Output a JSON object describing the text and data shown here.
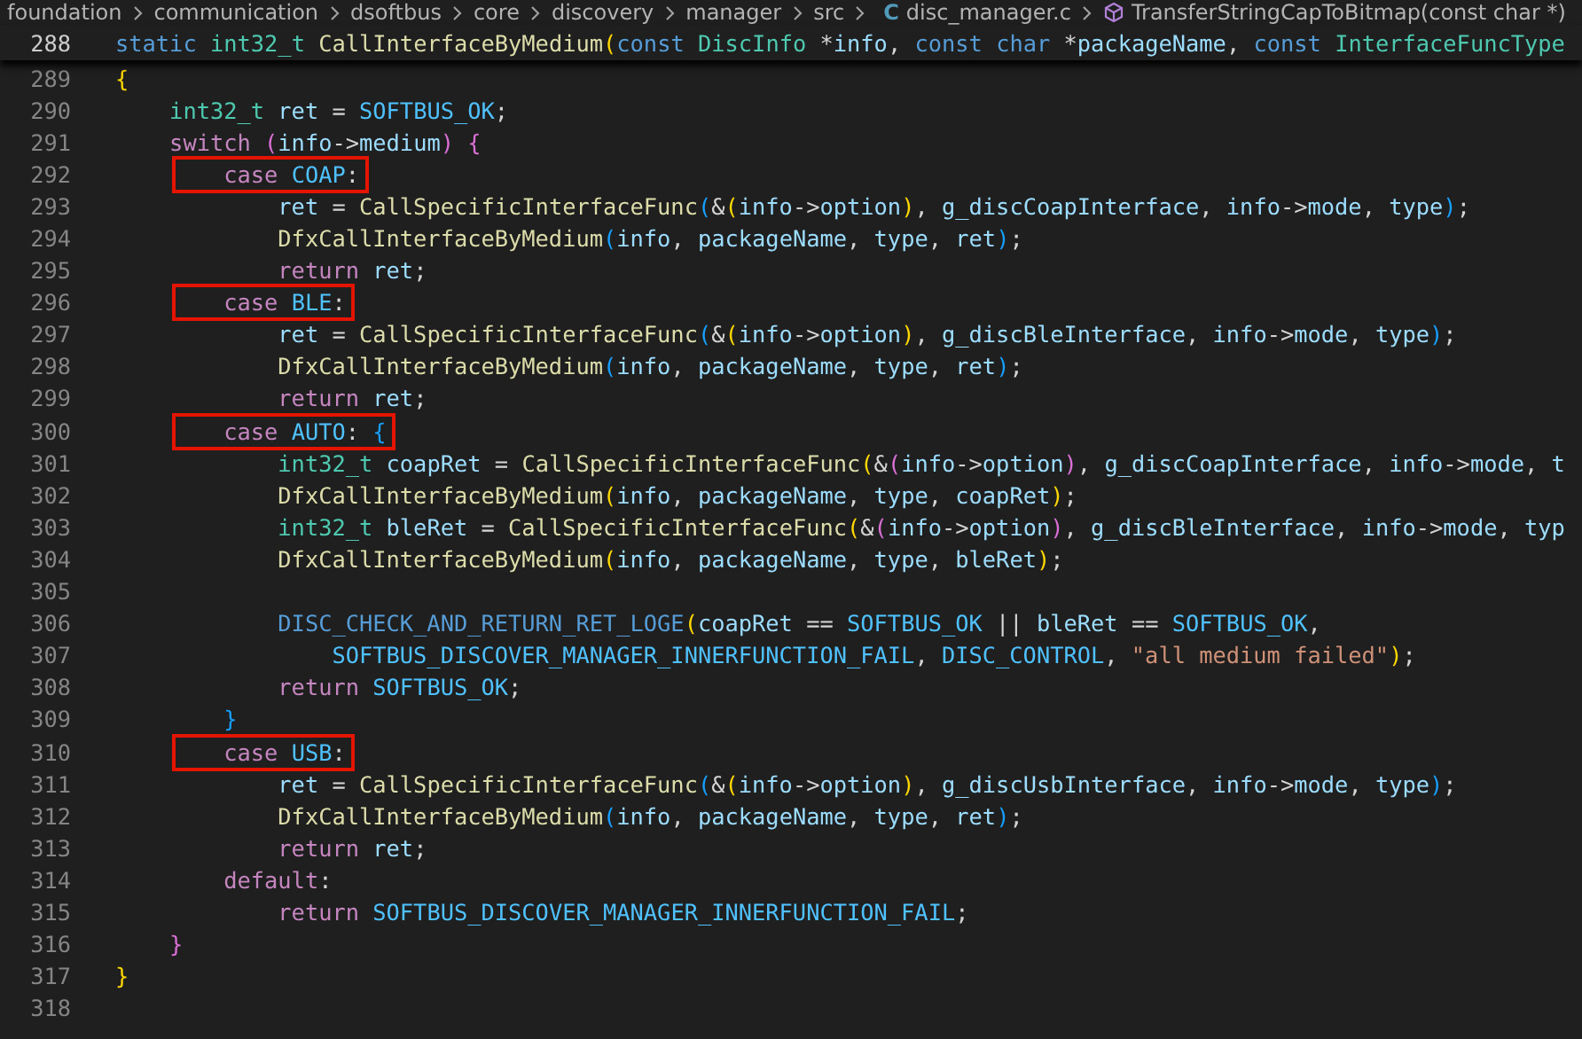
{
  "breadcrumb": {
    "segments": [
      "foundation",
      "communication",
      "dsoftbus",
      "core",
      "discovery",
      "manager",
      "src"
    ],
    "file_icon": "C",
    "file": "disc_manager.c",
    "symbol": "TransferStringCapToBitmap(const char *)"
  },
  "sticky_line": {
    "number": "288",
    "tokens": [
      {
        "kind": "st",
        "text": "static "
      },
      {
        "kind": "ty",
        "text": "int32_t "
      },
      {
        "kind": "fn",
        "text": "CallInterfaceByMedium"
      },
      {
        "kind": "br1",
        "text": "("
      },
      {
        "kind": "st",
        "text": "const "
      },
      {
        "kind": "ty",
        "text": "DiscInfo"
      },
      {
        "kind": "punct",
        "text": " *"
      },
      {
        "kind": "var",
        "text": "info"
      },
      {
        "kind": "punct",
        "text": ", "
      },
      {
        "kind": "st",
        "text": "const char"
      },
      {
        "kind": "punct",
        "text": " *"
      },
      {
        "kind": "var",
        "text": "packageName"
      },
      {
        "kind": "punct",
        "text": ", "
      },
      {
        "kind": "st",
        "text": "const "
      },
      {
        "kind": "ty",
        "text": "InterfaceFuncType"
      }
    ]
  },
  "lines": [
    {
      "number": "289",
      "highlighted": false,
      "tokens": [
        {
          "kind": "br1",
          "text": "{"
        }
      ]
    },
    {
      "number": "290",
      "highlighted": false,
      "tokens": [
        {
          "kind": "ty",
          "text": "    int32_t "
        },
        {
          "kind": "var",
          "text": "ret"
        },
        {
          "kind": "punct",
          "text": " = "
        },
        {
          "kind": "const",
          "text": "SOFTBUS_OK"
        },
        {
          "kind": "punct",
          "text": ";"
        }
      ]
    },
    {
      "number": "291",
      "highlighted": false,
      "tokens": [
        {
          "kind": "kw",
          "text": "    switch "
        },
        {
          "kind": "br2",
          "text": "("
        },
        {
          "kind": "var",
          "text": "info"
        },
        {
          "kind": "punct",
          "text": "->"
        },
        {
          "kind": "var",
          "text": "medium"
        },
        {
          "kind": "br2",
          "text": ") {"
        }
      ]
    },
    {
      "number": "292",
      "highlighted": true,
      "tokens": [
        {
          "kind": "kw",
          "text": "        case "
        },
        {
          "kind": "const",
          "text": "COAP"
        },
        {
          "kind": "punct",
          "text": ":"
        }
      ]
    },
    {
      "number": "293",
      "highlighted": false,
      "tokens": [
        {
          "kind": "var",
          "text": "            ret"
        },
        {
          "kind": "punct",
          "text": " = "
        },
        {
          "kind": "fn",
          "text": "CallSpecificInterfaceFunc"
        },
        {
          "kind": "br3",
          "text": "("
        },
        {
          "kind": "punct",
          "text": "&"
        },
        {
          "kind": "br1",
          "text": "("
        },
        {
          "kind": "var",
          "text": "info"
        },
        {
          "kind": "punct",
          "text": "->"
        },
        {
          "kind": "var",
          "text": "option"
        },
        {
          "kind": "br1",
          "text": ")"
        },
        {
          "kind": "punct",
          "text": ", "
        },
        {
          "kind": "var",
          "text": "g_discCoapInterface"
        },
        {
          "kind": "punct",
          "text": ", "
        },
        {
          "kind": "var",
          "text": "info"
        },
        {
          "kind": "punct",
          "text": "->"
        },
        {
          "kind": "var",
          "text": "mode"
        },
        {
          "kind": "punct",
          "text": ", "
        },
        {
          "kind": "var",
          "text": "type"
        },
        {
          "kind": "br3",
          "text": ")"
        },
        {
          "kind": "punct",
          "text": ";"
        }
      ]
    },
    {
      "number": "294",
      "highlighted": false,
      "tokens": [
        {
          "kind": "fn",
          "text": "            DfxCallInterfaceByMedium"
        },
        {
          "kind": "br3",
          "text": "("
        },
        {
          "kind": "var",
          "text": "info"
        },
        {
          "kind": "punct",
          "text": ", "
        },
        {
          "kind": "var",
          "text": "packageName"
        },
        {
          "kind": "punct",
          "text": ", "
        },
        {
          "kind": "var",
          "text": "type"
        },
        {
          "kind": "punct",
          "text": ", "
        },
        {
          "kind": "var",
          "text": "ret"
        },
        {
          "kind": "br3",
          "text": ")"
        },
        {
          "kind": "punct",
          "text": ";"
        }
      ]
    },
    {
      "number": "295",
      "highlighted": false,
      "tokens": [
        {
          "kind": "kw",
          "text": "            return "
        },
        {
          "kind": "var",
          "text": "ret"
        },
        {
          "kind": "punct",
          "text": ";"
        }
      ]
    },
    {
      "number": "296",
      "highlighted": true,
      "tokens": [
        {
          "kind": "kw",
          "text": "        case "
        },
        {
          "kind": "const",
          "text": "BLE"
        },
        {
          "kind": "punct",
          "text": ":"
        }
      ]
    },
    {
      "number": "297",
      "highlighted": false,
      "tokens": [
        {
          "kind": "var",
          "text": "            ret"
        },
        {
          "kind": "punct",
          "text": " = "
        },
        {
          "kind": "fn",
          "text": "CallSpecificInterfaceFunc"
        },
        {
          "kind": "br3",
          "text": "("
        },
        {
          "kind": "punct",
          "text": "&"
        },
        {
          "kind": "br1",
          "text": "("
        },
        {
          "kind": "var",
          "text": "info"
        },
        {
          "kind": "punct",
          "text": "->"
        },
        {
          "kind": "var",
          "text": "option"
        },
        {
          "kind": "br1",
          "text": ")"
        },
        {
          "kind": "punct",
          "text": ", "
        },
        {
          "kind": "var",
          "text": "g_discBleInterface"
        },
        {
          "kind": "punct",
          "text": ", "
        },
        {
          "kind": "var",
          "text": "info"
        },
        {
          "kind": "punct",
          "text": "->"
        },
        {
          "kind": "var",
          "text": "mode"
        },
        {
          "kind": "punct",
          "text": ", "
        },
        {
          "kind": "var",
          "text": "type"
        },
        {
          "kind": "br3",
          "text": ")"
        },
        {
          "kind": "punct",
          "text": ";"
        }
      ]
    },
    {
      "number": "298",
      "highlighted": false,
      "tokens": [
        {
          "kind": "fn",
          "text": "            DfxCallInterfaceByMedium"
        },
        {
          "kind": "br3",
          "text": "("
        },
        {
          "kind": "var",
          "text": "info"
        },
        {
          "kind": "punct",
          "text": ", "
        },
        {
          "kind": "var",
          "text": "packageName"
        },
        {
          "kind": "punct",
          "text": ", "
        },
        {
          "kind": "var",
          "text": "type"
        },
        {
          "kind": "punct",
          "text": ", "
        },
        {
          "kind": "var",
          "text": "ret"
        },
        {
          "kind": "br3",
          "text": ")"
        },
        {
          "kind": "punct",
          "text": ";"
        }
      ]
    },
    {
      "number": "299",
      "highlighted": false,
      "tokens": [
        {
          "kind": "kw",
          "text": "            return "
        },
        {
          "kind": "var",
          "text": "ret"
        },
        {
          "kind": "punct",
          "text": ";"
        }
      ]
    },
    {
      "number": "300",
      "highlighted": true,
      "tokens": [
        {
          "kind": "kw",
          "text": "        case "
        },
        {
          "kind": "const",
          "text": "AUTO"
        },
        {
          "kind": "punct",
          "text": ": "
        },
        {
          "kind": "br3",
          "text": "{"
        }
      ]
    },
    {
      "number": "301",
      "highlighted": false,
      "tokens": [
        {
          "kind": "ty",
          "text": "            int32_t "
        },
        {
          "kind": "var",
          "text": "coapRet"
        },
        {
          "kind": "punct",
          "text": " = "
        },
        {
          "kind": "fn",
          "text": "CallSpecificInterfaceFunc"
        },
        {
          "kind": "br1",
          "text": "("
        },
        {
          "kind": "punct",
          "text": "&"
        },
        {
          "kind": "br2",
          "text": "("
        },
        {
          "kind": "var",
          "text": "info"
        },
        {
          "kind": "punct",
          "text": "->"
        },
        {
          "kind": "var",
          "text": "option"
        },
        {
          "kind": "br2",
          "text": ")"
        },
        {
          "kind": "punct",
          "text": ", "
        },
        {
          "kind": "var",
          "text": "g_discCoapInterface"
        },
        {
          "kind": "punct",
          "text": ", "
        },
        {
          "kind": "var",
          "text": "info"
        },
        {
          "kind": "punct",
          "text": "->"
        },
        {
          "kind": "var",
          "text": "mode"
        },
        {
          "kind": "punct",
          "text": ", "
        },
        {
          "kind": "var",
          "text": "t"
        }
      ]
    },
    {
      "number": "302",
      "highlighted": false,
      "tokens": [
        {
          "kind": "fn",
          "text": "            DfxCallInterfaceByMedium"
        },
        {
          "kind": "br1",
          "text": "("
        },
        {
          "kind": "var",
          "text": "info"
        },
        {
          "kind": "punct",
          "text": ", "
        },
        {
          "kind": "var",
          "text": "packageName"
        },
        {
          "kind": "punct",
          "text": ", "
        },
        {
          "kind": "var",
          "text": "type"
        },
        {
          "kind": "punct",
          "text": ", "
        },
        {
          "kind": "var",
          "text": "coapRet"
        },
        {
          "kind": "br1",
          "text": ")"
        },
        {
          "kind": "punct",
          "text": ";"
        }
      ]
    },
    {
      "number": "303",
      "highlighted": false,
      "tokens": [
        {
          "kind": "ty",
          "text": "            int32_t "
        },
        {
          "kind": "var",
          "text": "bleRet"
        },
        {
          "kind": "punct",
          "text": " = "
        },
        {
          "kind": "fn",
          "text": "CallSpecificInterfaceFunc"
        },
        {
          "kind": "br1",
          "text": "("
        },
        {
          "kind": "punct",
          "text": "&"
        },
        {
          "kind": "br2",
          "text": "("
        },
        {
          "kind": "var",
          "text": "info"
        },
        {
          "kind": "punct",
          "text": "->"
        },
        {
          "kind": "var",
          "text": "option"
        },
        {
          "kind": "br2",
          "text": ")"
        },
        {
          "kind": "punct",
          "text": ", "
        },
        {
          "kind": "var",
          "text": "g_discBleInterface"
        },
        {
          "kind": "punct",
          "text": ", "
        },
        {
          "kind": "var",
          "text": "info"
        },
        {
          "kind": "punct",
          "text": "->"
        },
        {
          "kind": "var",
          "text": "mode"
        },
        {
          "kind": "punct",
          "text": ", "
        },
        {
          "kind": "var",
          "text": "typ"
        }
      ]
    },
    {
      "number": "304",
      "highlighted": false,
      "tokens": [
        {
          "kind": "fn",
          "text": "            DfxCallInterfaceByMedium"
        },
        {
          "kind": "br1",
          "text": "("
        },
        {
          "kind": "var",
          "text": "info"
        },
        {
          "kind": "punct",
          "text": ", "
        },
        {
          "kind": "var",
          "text": "packageName"
        },
        {
          "kind": "punct",
          "text": ", "
        },
        {
          "kind": "var",
          "text": "type"
        },
        {
          "kind": "punct",
          "text": ", "
        },
        {
          "kind": "var",
          "text": "bleRet"
        },
        {
          "kind": "br1",
          "text": ")"
        },
        {
          "kind": "punct",
          "text": ";"
        }
      ]
    },
    {
      "number": "305",
      "highlighted": false
    },
    {
      "number": "306",
      "highlighted": false,
      "tokens": [
        {
          "kind": "st",
          "text": "            DISC_CHECK_AND_RETURN_RET_LOGE"
        },
        {
          "kind": "br1",
          "text": "("
        },
        {
          "kind": "var",
          "text": "coapRet"
        },
        {
          "kind": "punct",
          "text": " == "
        },
        {
          "kind": "const",
          "text": "SOFTBUS_OK"
        },
        {
          "kind": "punct",
          "text": " || "
        },
        {
          "kind": "var",
          "text": "bleRet"
        },
        {
          "kind": "punct",
          "text": " == "
        },
        {
          "kind": "const",
          "text": "SOFTBUS_OK"
        },
        {
          "kind": "punct",
          "text": ","
        }
      ]
    },
    {
      "number": "307",
      "highlighted": false,
      "tokens": [
        {
          "kind": "const",
          "text": "                SOFTBUS_DISCOVER_MANAGER_INNERFUNCTION_FAIL"
        },
        {
          "kind": "punct",
          "text": ", "
        },
        {
          "kind": "const",
          "text": "DISC_CONTROL"
        },
        {
          "kind": "punct",
          "text": ", "
        },
        {
          "kind": "str",
          "text": "\"all medium failed\""
        },
        {
          "kind": "br1",
          "text": ")"
        },
        {
          "kind": "punct",
          "text": ";"
        }
      ]
    },
    {
      "number": "308",
      "highlighted": false,
      "tokens": [
        {
          "kind": "kw",
          "text": "            return "
        },
        {
          "kind": "const",
          "text": "SOFTBUS_OK"
        },
        {
          "kind": "punct",
          "text": ";"
        }
      ]
    },
    {
      "number": "309",
      "highlighted": false,
      "tokens": [
        {
          "kind": "br3",
          "text": "        }"
        }
      ]
    },
    {
      "number": "310",
      "highlighted": true,
      "tokens": [
        {
          "kind": "kw",
          "text": "        case "
        },
        {
          "kind": "const",
          "text": "USB"
        },
        {
          "kind": "punct",
          "text": ":"
        }
      ]
    },
    {
      "number": "311",
      "highlighted": false,
      "tokens": [
        {
          "kind": "var",
          "text": "            ret"
        },
        {
          "kind": "punct",
          "text": " = "
        },
        {
          "kind": "fn",
          "text": "CallSpecificInterfaceFunc"
        },
        {
          "kind": "br3",
          "text": "("
        },
        {
          "kind": "punct",
          "text": "&"
        },
        {
          "kind": "br1",
          "text": "("
        },
        {
          "kind": "var",
          "text": "info"
        },
        {
          "kind": "punct",
          "text": "->"
        },
        {
          "kind": "var",
          "text": "option"
        },
        {
          "kind": "br1",
          "text": ")"
        },
        {
          "kind": "punct",
          "text": ", "
        },
        {
          "kind": "var",
          "text": "g_discUsbInterface"
        },
        {
          "kind": "punct",
          "text": ", "
        },
        {
          "kind": "var",
          "text": "info"
        },
        {
          "kind": "punct",
          "text": "->"
        },
        {
          "kind": "var",
          "text": "mode"
        },
        {
          "kind": "punct",
          "text": ", "
        },
        {
          "kind": "var",
          "text": "type"
        },
        {
          "kind": "br3",
          "text": ")"
        },
        {
          "kind": "punct",
          "text": ";"
        }
      ]
    },
    {
      "number": "312",
      "highlighted": false,
      "tokens": [
        {
          "kind": "fn",
          "text": "            DfxCallInterfaceByMedium"
        },
        {
          "kind": "br3",
          "text": "("
        },
        {
          "kind": "var",
          "text": "info"
        },
        {
          "kind": "punct",
          "text": ", "
        },
        {
          "kind": "var",
          "text": "packageName"
        },
        {
          "kind": "punct",
          "text": ", "
        },
        {
          "kind": "var",
          "text": "type"
        },
        {
          "kind": "punct",
          "text": ", "
        },
        {
          "kind": "var",
          "text": "ret"
        },
        {
          "kind": "br3",
          "text": ")"
        },
        {
          "kind": "punct",
          "text": ";"
        }
      ]
    },
    {
      "number": "313",
      "highlighted": false,
      "tokens": [
        {
          "kind": "kw",
          "text": "            return "
        },
        {
          "kind": "var",
          "text": "ret"
        },
        {
          "kind": "punct",
          "text": ";"
        }
      ]
    },
    {
      "number": "314",
      "highlighted": false,
      "tokens": [
        {
          "kind": "kw",
          "text": "        default"
        },
        {
          "kind": "punct",
          "text": ":"
        }
      ]
    },
    {
      "number": "315",
      "highlighted": false,
      "tokens": [
        {
          "kind": "kw",
          "text": "            return "
        },
        {
          "kind": "const",
          "text": "SOFTBUS_DISCOVER_MANAGER_INNERFUNCTION_FAIL"
        },
        {
          "kind": "punct",
          "text": ";"
        }
      ]
    },
    {
      "number": "316",
      "highlighted": false,
      "tokens": [
        {
          "kind": "br2",
          "text": "    }"
        }
      ]
    },
    {
      "number": "317",
      "highlighted": false,
      "tokens": [
        {
          "kind": "br1",
          "text": "}"
        }
      ]
    },
    {
      "number": "318",
      "highlighted": false
    }
  ]
}
